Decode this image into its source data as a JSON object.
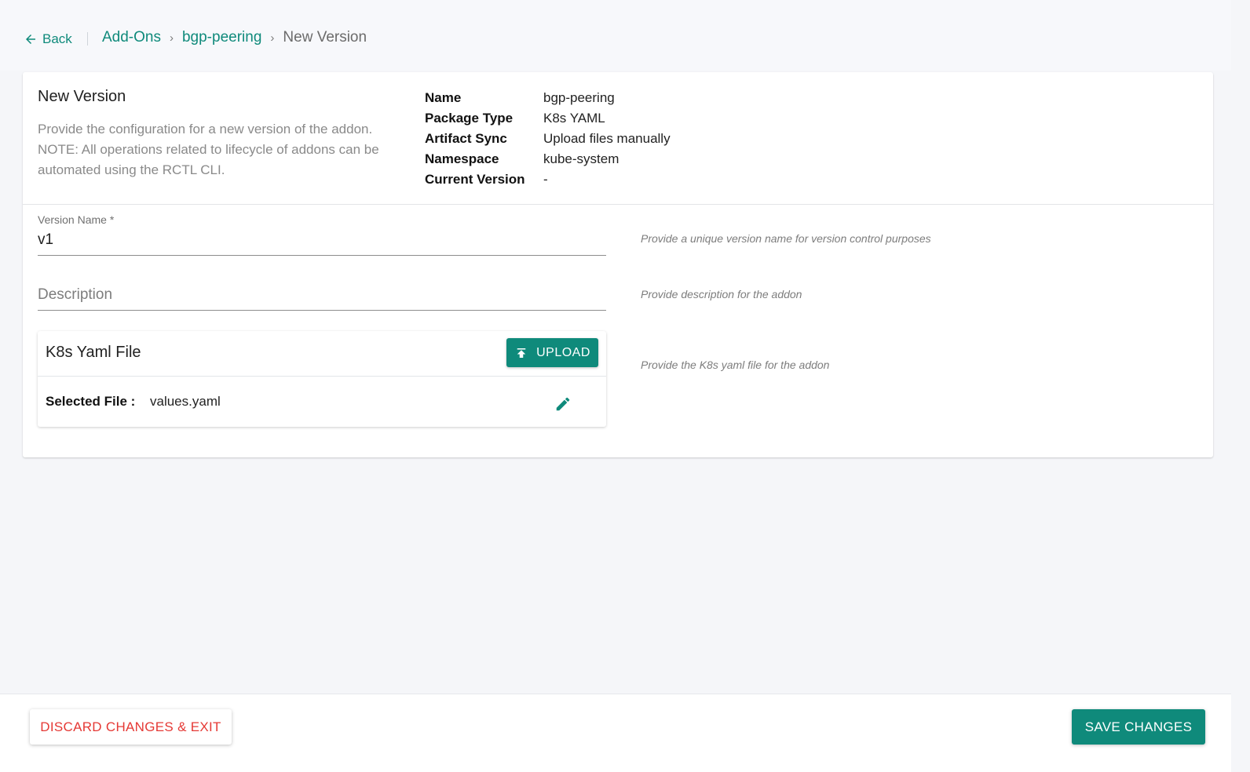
{
  "breadcrumb": {
    "back_label": "Back",
    "items": [
      "Add-Ons",
      "bgp-peering"
    ],
    "current": "New Version",
    "separator": "›"
  },
  "header": {
    "title": "New Version",
    "description": "Provide the configuration for a new version of the addon. NOTE: All operations related to lifecycle of addons can be automated using the RCTL CLI."
  },
  "info": [
    {
      "key": "Name",
      "value": "bgp-peering"
    },
    {
      "key": "Package Type",
      "value": "K8s YAML"
    },
    {
      "key": "Artifact Sync",
      "value": "Upload files manually"
    },
    {
      "key": "Namespace",
      "value": "kube-system"
    },
    {
      "key": "Current Version",
      "value": "-"
    }
  ],
  "form": {
    "version_name": {
      "label": "Version Name *",
      "value": "v1",
      "hint": "Provide a unique version name for version control purposes"
    },
    "description": {
      "placeholder": "Description",
      "value": "",
      "hint": "Provide description for the addon"
    },
    "yaml_file": {
      "title": "K8s Yaml File",
      "upload_label": "UPLOAD",
      "selected_label": "Selected File :",
      "selected_value": "values.yaml",
      "hint": "Provide the K8s yaml file for the addon"
    }
  },
  "footer": {
    "discard_label": "DISCARD CHANGES & EXIT",
    "save_label": "SAVE CHANGES"
  },
  "colors": {
    "accent": "#0f8a7b",
    "danger": "#e53935",
    "background": "#f5f6f9"
  },
  "icons": {
    "back": "arrow-left-icon",
    "upload": "upload-icon",
    "edit": "pencil-icon"
  }
}
